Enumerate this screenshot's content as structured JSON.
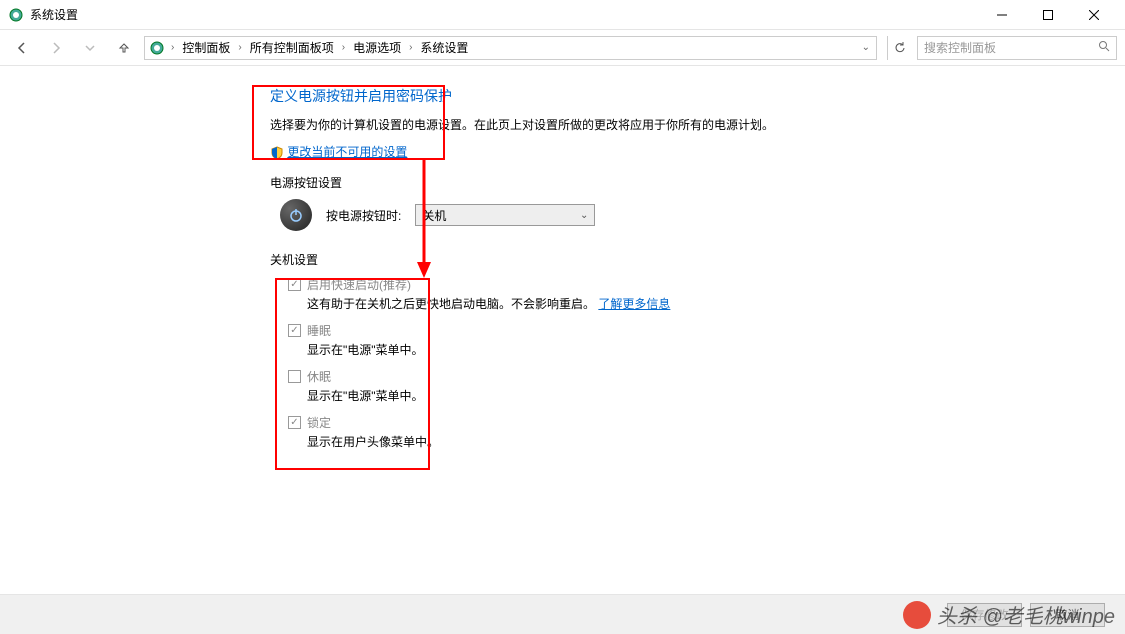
{
  "window": {
    "title": "系统设置"
  },
  "breadcrumb": [
    "控制面板",
    "所有控制面板项",
    "电源选项",
    "系统设置"
  ],
  "search": {
    "placeholder": "搜索控制面板"
  },
  "page": {
    "title": "定义电源按钮并启用密码保护",
    "desc": "选择要为你的计算机设置的电源设置。在此页上对设置所做的更改将应用于你所有的电源计划。",
    "change_link": "更改当前不可用的设置"
  },
  "sections": {
    "button_settings": "电源按钮设置",
    "power_button_label": "按电源按钮时:",
    "power_button_value": "关机",
    "shutdown_settings": "关机设置"
  },
  "options": [
    {
      "checked": true,
      "label": "启用快速启动(推荐)",
      "desc": "这有助于在关机之后更快地启动电脑。不会影响重启。",
      "more": "了解更多信息"
    },
    {
      "checked": true,
      "label": "睡眠",
      "desc": "显示在\"电源\"菜单中。"
    },
    {
      "checked": false,
      "label": "休眠",
      "desc": "显示在\"电源\"菜单中。"
    },
    {
      "checked": true,
      "label": "锁定",
      "desc": "显示在用户头像菜单中。"
    }
  ],
  "footer": {
    "save": "保存修改",
    "cancel": "取消"
  },
  "watermark": "头杀 @老毛桃winpe"
}
